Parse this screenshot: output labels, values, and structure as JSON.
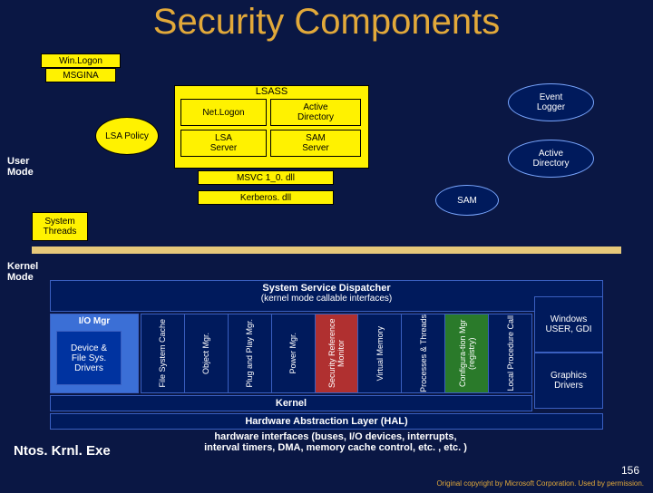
{
  "title": "Security Components",
  "user_mode_label": "User\nMode",
  "kernel_mode_label": "Kernel\nMode",
  "boxes": {
    "winlogon": "Win.Logon",
    "msgina": "MSGINA",
    "lsa_policy": "LSA\nPolicy",
    "system_threads": "System\nThreads",
    "lsass": "LSASS",
    "netlogon": "Net.Logon",
    "active_directory_inner": "Active\nDirectory",
    "lsa_server": "LSA\nServer",
    "sam_server": "SAM\nServer",
    "msvc": "MSVC 1_0. dll",
    "kerberos": "Kerberos. dll",
    "event_logger": "Event\nLogger",
    "active_directory_oval": "Active\nDirectory",
    "sam_oval": "SAM"
  },
  "kernel": {
    "dispatcher": "System Service Dispatcher",
    "dispatcher_sub": "(kernel mode callable interfaces)",
    "io_mgr": "I/O Mgr",
    "drivers": "Device &\nFile Sys.\nDrivers",
    "cols": [
      "File System Cache",
      "Object Mgr.",
      "Plug and Play Mgr.",
      "Power Mgr.",
      "Security Reference Monitor",
      "Virtual Memory",
      "Processes & Threads",
      "Configura-tion Mgr (registry)",
      "Local Procedure Call"
    ],
    "right": {
      "user_gdi": "Windows USER, GDI",
      "graphics": "Graphics Drivers"
    },
    "kernel_bar": "Kernel",
    "hal_bar": "Hardware Abstraction Layer (HAL)",
    "hw_text": "hardware interfaces (buses, I/O devices, interrupts,\ninterval timers, DMA, memory cache control, etc. , etc. )",
    "ntos": "Ntos. Krnl. Exe"
  },
  "footer": {
    "copyright": "Original copyright by Microsoft Corporation. Used by permission.",
    "page": "156"
  }
}
